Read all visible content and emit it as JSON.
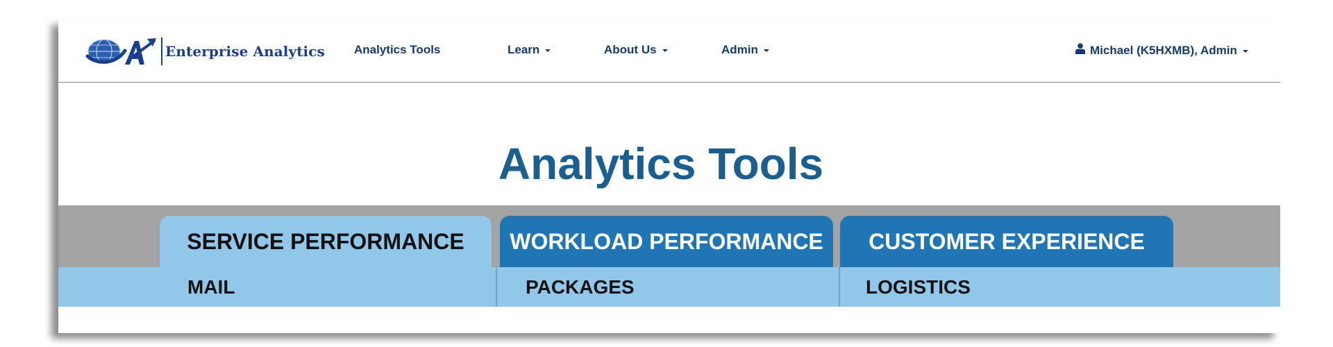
{
  "brand": {
    "name": "Enterprise Analytics",
    "colors": {
      "primary": "#1b3f8f",
      "accent": "#2a8fd6"
    }
  },
  "nav": {
    "items": [
      {
        "label": "Analytics Tools",
        "dropdown": false
      },
      {
        "label": "Learn",
        "dropdown": true
      },
      {
        "label": "About Us",
        "dropdown": true
      },
      {
        "label": "Admin",
        "dropdown": true
      }
    ],
    "user": {
      "icon": "user-icon",
      "label": "Michael (K5HXMB), Admin",
      "dropdown": true
    }
  },
  "page": {
    "title": "Analytics Tools"
  },
  "tabs": [
    {
      "label": "SERVICE PERFORMANCE",
      "active": true
    },
    {
      "label": "WORKLOAD PERFORMANCE",
      "active": false
    },
    {
      "label": "CUSTOMER EXPERIENCE",
      "active": false
    }
  ],
  "subnav": [
    {
      "label": "MAIL"
    },
    {
      "label": "PACKAGES"
    },
    {
      "label": "LOGISTICS"
    }
  ],
  "colors": {
    "title": "#1a5f8f",
    "tab_active": "#93c7ea",
    "tab_inactive": "#2076b5",
    "band": "#a3a3a3"
  }
}
